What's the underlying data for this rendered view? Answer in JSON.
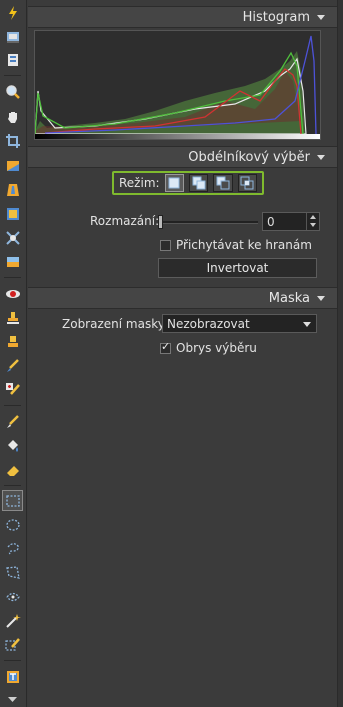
{
  "toolbar": {
    "tools": [
      {
        "name": "flash-icon"
      },
      {
        "name": "camera-import-icon"
      },
      {
        "name": "batch-icon"
      },
      {
        "name": "zoom-icon"
      },
      {
        "name": "hand-pan-icon"
      },
      {
        "name": "crop-icon"
      },
      {
        "name": "straighten-icon"
      },
      {
        "name": "perspective-icon"
      },
      {
        "name": "frame-icon"
      },
      {
        "name": "distortion-icon"
      },
      {
        "name": "gradient-icon"
      },
      {
        "name": "red-eye-icon"
      },
      {
        "name": "clone-stamp-icon"
      },
      {
        "name": "healing-icon"
      },
      {
        "name": "brush-retouch-icon"
      },
      {
        "name": "spot-repair-icon"
      },
      {
        "name": "paint-brush-icon"
      },
      {
        "name": "paint-bucket-icon"
      },
      {
        "name": "eraser-icon"
      },
      {
        "name": "rect-select-icon"
      },
      {
        "name": "ellipse-select-icon"
      },
      {
        "name": "lasso-select-icon"
      },
      {
        "name": "polygon-select-icon"
      },
      {
        "name": "magnetic-select-icon"
      },
      {
        "name": "magic-wand-icon"
      },
      {
        "name": "selection-brush-icon"
      },
      {
        "name": "text-icon"
      }
    ],
    "more_icon": "chevron-down-icon"
  },
  "histogram": {
    "title": "Histogram"
  },
  "rect_select": {
    "title": "Obdélníkový výběr",
    "mode_label": "Režim:",
    "modes": [
      {
        "name": "mode-new-selection-icon"
      },
      {
        "name": "mode-add-selection-icon"
      },
      {
        "name": "mode-subtract-selection-icon"
      },
      {
        "name": "mode-intersect-selection-icon"
      }
    ],
    "blur_label": "Rozmazání:",
    "blur_value": "0",
    "snap_label": "Přichytávat ke hranám",
    "snap_checked": false,
    "invert_label": "Invertovat"
  },
  "mask": {
    "title": "Maska",
    "display_label": "Zobrazení masky:",
    "display_value": "Nezobrazovat",
    "outline_label": "Obrys výběru",
    "outline_checked": true
  },
  "colors": {
    "accent_highlight": "#7fba2e",
    "panel_bg": "#3b3b3b",
    "header_bg": "#454545"
  }
}
